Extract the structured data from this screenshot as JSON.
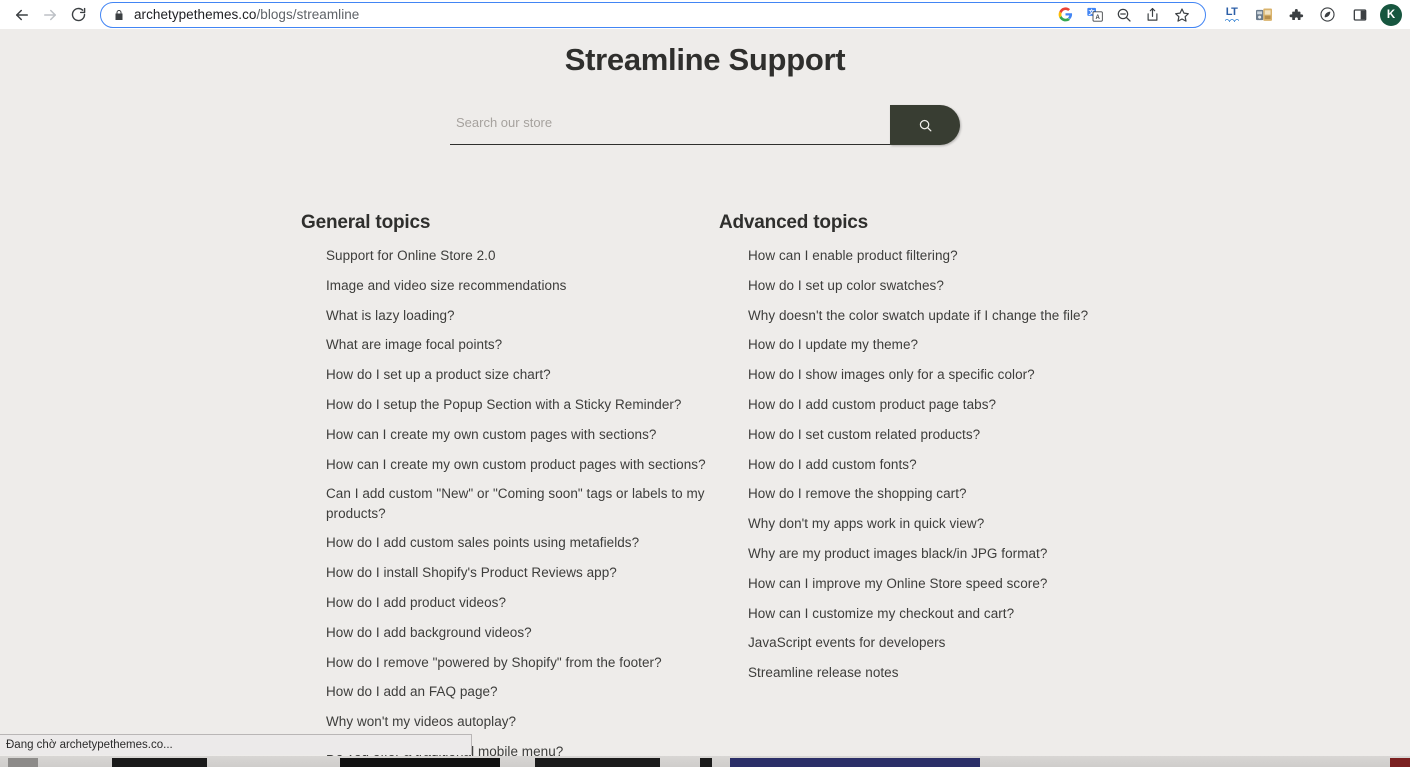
{
  "browser": {
    "back_icon": "back-arrow-icon",
    "forward_icon": "forward-arrow-icon",
    "reload_icon": "reload-icon",
    "lock_icon": "lock-icon",
    "url_host": "archetypethemes.co",
    "url_path": "/blogs/streamline",
    "omnibox_icons": [
      "google-icon",
      "translate-icon",
      "zoom-out-icon",
      "share-icon",
      "bookmark-star-icon"
    ],
    "extension_icons": [
      "languagetool-icon",
      "extension-colorful-icon",
      "puzzle-extensions-icon",
      "eco-leaf-icon",
      "side-panel-icon"
    ],
    "avatar_initial": "K",
    "avatar_color": "#17563f"
  },
  "page": {
    "title": "Streamline Support",
    "background_color": "#eeecea",
    "text_color": "#2f2f2d",
    "accent_color": "#383d32",
    "search": {
      "placeholder": "Search our store",
      "value": "",
      "button_icon": "search-icon"
    },
    "columns": [
      {
        "heading": "General topics",
        "items": [
          "Support for Online Store 2.0",
          "Image and video size recommendations",
          "What is lazy loading?",
          "What are image focal points?",
          "How do I set up a product size chart?",
          "How do I setup the Popup Section with a Sticky Reminder?",
          "How can I create my own custom pages with sections?",
          "How can I create my own custom product pages with sections?",
          "Can I add custom \"New\" or \"Coming soon\" tags or labels to my products?",
          "How do I add custom sales points using metafields?",
          "How do I install Shopify's Product Reviews app?",
          "How do I add product videos?",
          "How do I add background videos?",
          "How do I remove \"powered by Shopify\" from the footer?",
          "How do I add an FAQ page?",
          "Why won't my videos autoplay?",
          "Do you offer a traditional mobile menu?"
        ]
      },
      {
        "heading": "Advanced topics",
        "items": [
          "How can I enable product filtering?",
          "How do I set up color swatches?",
          "Why doesn't the color swatch update if I change the file?",
          "How do I update my theme?",
          "How do I show images only for a specific color?",
          "How do I add custom product page tabs?",
          "How do I set custom related products?",
          "How do I add custom fonts?",
          "How do I remove the shopping cart?",
          "Why don't my apps work in quick view?",
          "Why are my product images black/in JPG format?",
          "How can I improve my Online Store speed score?",
          "How can I customize my checkout and cart?",
          "JavaScript events for developers",
          "Streamline release notes"
        ]
      }
    ]
  },
  "status": {
    "text": "Đang chờ archetypethemes.co..."
  }
}
